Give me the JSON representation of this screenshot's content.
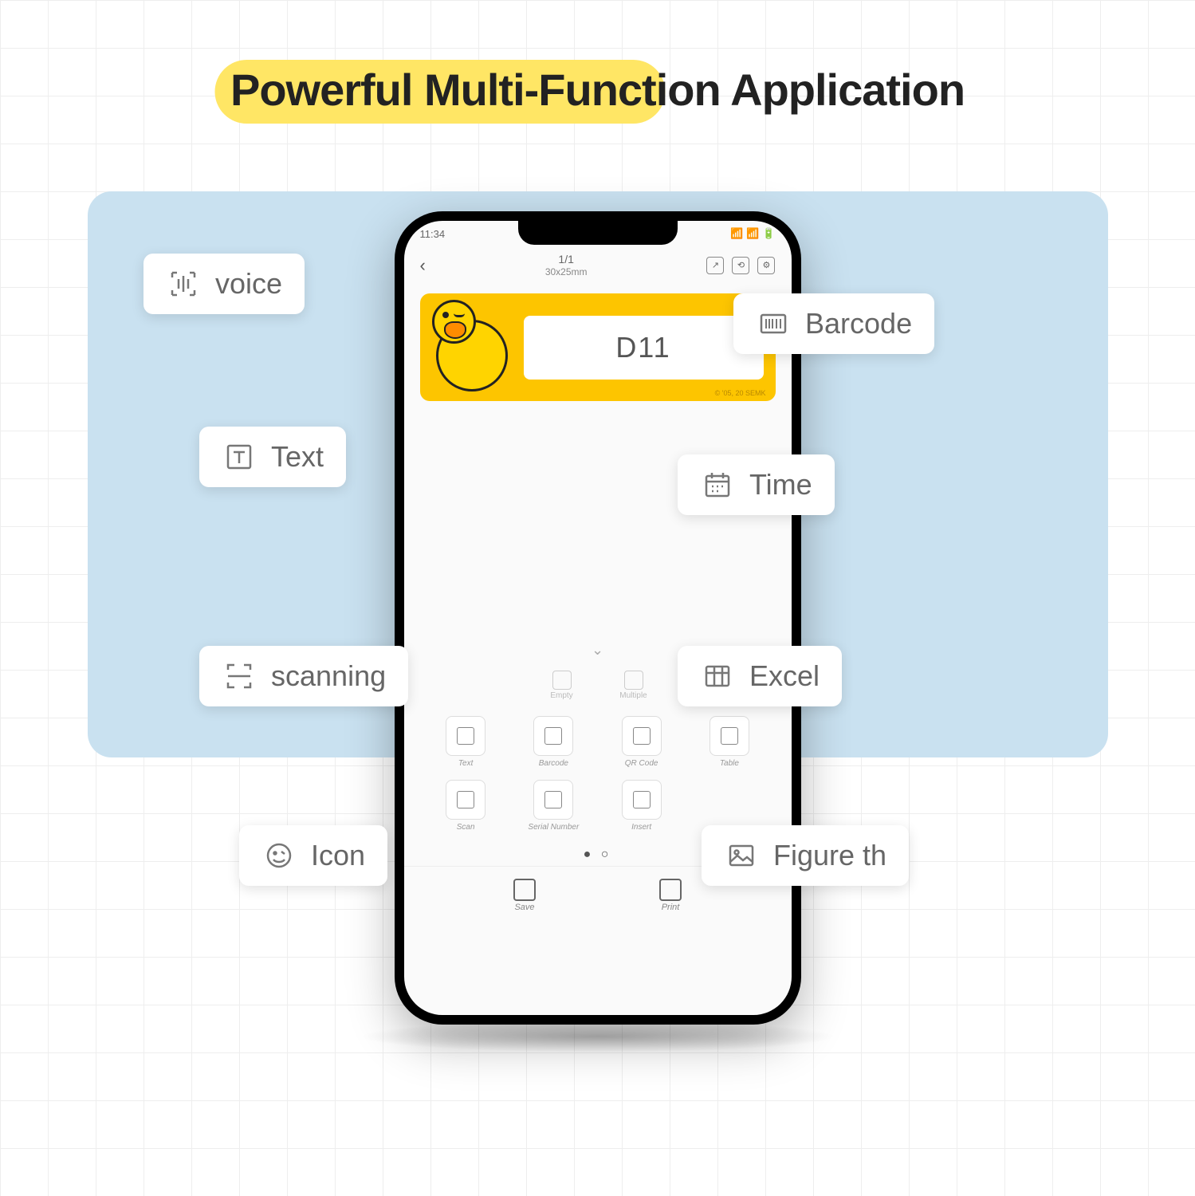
{
  "heading": "Powerful Multi-Function Application",
  "status": {
    "time": "11:34"
  },
  "header": {
    "counter": "1/1",
    "dimensions": "30x25mm"
  },
  "label": {
    "text": "D11",
    "copyright": "© '05, 20 SEMK"
  },
  "mini_tools": [
    {
      "label": "Empty"
    },
    {
      "label": "Multiple"
    }
  ],
  "grid": [
    {
      "label": "Text"
    },
    {
      "label": "Barcode"
    },
    {
      "label": "QR Code"
    },
    {
      "label": "Table"
    },
    {
      "label": "Scan"
    },
    {
      "label": "Serial Number"
    },
    {
      "label": "Insert"
    }
  ],
  "bottom": [
    {
      "label": "Save"
    },
    {
      "label": "Print"
    }
  ],
  "callouts": {
    "voice": "voice",
    "barcode": "Barcode",
    "text": "Text",
    "time": "Time",
    "scanning": "scanning",
    "excel": "Excel",
    "icon": "Icon",
    "figure": "Figure th"
  }
}
